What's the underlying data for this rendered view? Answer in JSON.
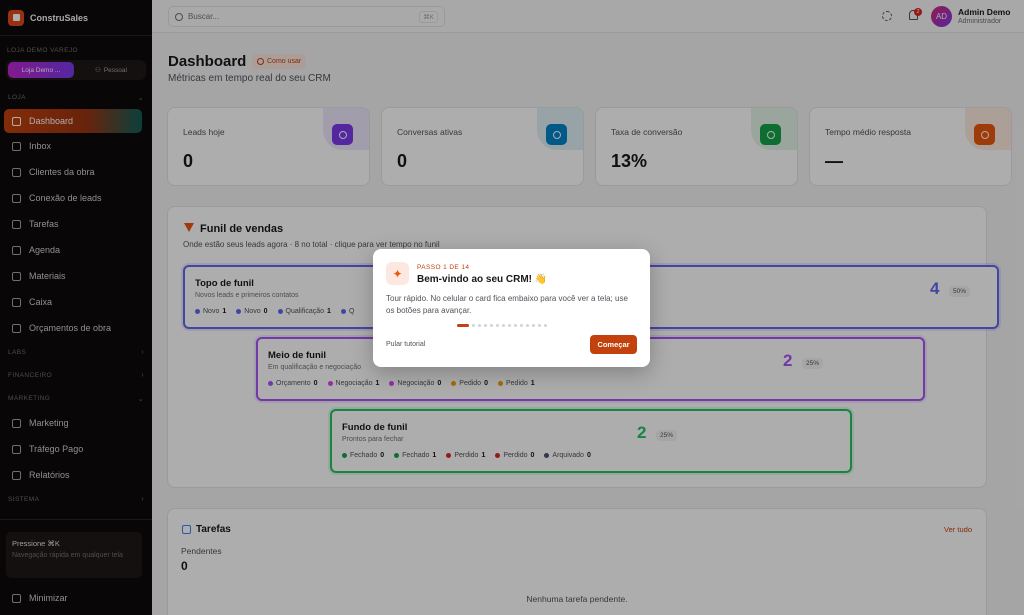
{
  "app": {
    "name": "ConstruSales"
  },
  "store": {
    "section_label": "LOJA DEMO VAREJO",
    "active": "Loja Demo ...",
    "personal": "Pessoal"
  },
  "sidebar": {
    "loja_label": "LOJA",
    "items": [
      {
        "label": "Dashboard",
        "icon": "dashboard-icon"
      },
      {
        "label": "Inbox",
        "icon": "inbox-icon"
      },
      {
        "label": "Clientes da obra",
        "icon": "users-icon"
      },
      {
        "label": "Conexão de leads",
        "icon": "document-icon"
      },
      {
        "label": "Tarefas",
        "icon": "tasks-icon"
      },
      {
        "label": "Agenda",
        "icon": "calendar-icon"
      },
      {
        "label": "Materiais",
        "icon": "box-icon"
      },
      {
        "label": "Caixa",
        "icon": "cart-icon"
      },
      {
        "label": "Orçamentos de obra",
        "icon": "file-icon"
      }
    ],
    "labs_label": "LABS",
    "financeiro_label": "FINANCEIRO",
    "marketing_label": "MARKETING",
    "marketing_items": [
      {
        "label": "Marketing",
        "icon": "mail-icon"
      },
      {
        "label": "Tráfego Pago",
        "icon": "trend-icon"
      },
      {
        "label": "Relatórios",
        "icon": "chart-icon"
      }
    ],
    "sistema_label": "SISTEMA",
    "shortcut_title": "Pressione ⌘K",
    "shortcut_desc": "Navegação rápida em qualquer tela",
    "minimize": "Minimizar"
  },
  "topbar": {
    "search_placeholder": "Buscar...",
    "search_kbd": "⌘K",
    "notif_count": "2",
    "avatar_initials": "AD",
    "user_name": "Admin Demo",
    "user_role": "Administrador"
  },
  "header": {
    "title": "Dashboard",
    "howto": "Como usar",
    "subtitle": "Métricas em tempo real do seu CRM"
  },
  "stats": [
    {
      "label": "Leads hoje",
      "value": "0",
      "color": "#7c3aed"
    },
    {
      "label": "Conversas ativas",
      "value": "0",
      "color": "#0284c7"
    },
    {
      "label": "Taxa de conversão",
      "value": "13%",
      "color": "#16a34a"
    },
    {
      "label": "Tempo médio resposta",
      "value": "—",
      "color": "#ea580c"
    }
  ],
  "funnel": {
    "title": "Funil de vendas",
    "subtitle": "Onde estão seus leads agora · 8 no total · clique para ver tempo no funil",
    "stages": [
      {
        "name": "Topo de funil",
        "desc": "Novos leads e primeiros contatos",
        "count": "4",
        "pct": "50%",
        "color": "#6366f1",
        "tags": [
          {
            "label": "Novo",
            "n": "1",
            "color": "#6366f1"
          },
          {
            "label": "Novo",
            "n": "0",
            "color": "#6366f1"
          },
          {
            "label": "Qualificação",
            "n": "1",
            "color": "#6366f1"
          },
          {
            "label": "Q",
            "n": "",
            "color": "#6366f1"
          }
        ]
      },
      {
        "name": "Meio de funil",
        "desc": "Em qualificação e negociação",
        "count": "2",
        "pct": "25%",
        "color": "#a855f7",
        "tags": [
          {
            "label": "Orçamento",
            "n": "0",
            "color": "#a855f7"
          },
          {
            "label": "Negociação",
            "n": "1",
            "color": "#d946ef"
          },
          {
            "label": "Negociação",
            "n": "0",
            "color": "#d946ef"
          },
          {
            "label": "Pedido",
            "n": "0",
            "color": "#f59e0b"
          },
          {
            "label": "Pedido",
            "n": "1",
            "color": "#f59e0b"
          }
        ]
      },
      {
        "name": "Fundo de funil",
        "desc": "Prontos para fechar",
        "count": "2",
        "pct": "25%",
        "color": "#22c55e",
        "tags": [
          {
            "label": "Fechado",
            "n": "0",
            "color": "#16a34a"
          },
          {
            "label": "Fechado",
            "n": "1",
            "color": "#16a34a"
          },
          {
            "label": "Perdido",
            "n": "1",
            "color": "#dc2626"
          },
          {
            "label": "Perdido",
            "n": "0",
            "color": "#dc2626"
          },
          {
            "label": "Arquivado",
            "n": "0",
            "color": "#475569"
          }
        ]
      }
    ]
  },
  "tasks": {
    "title": "Tarefas",
    "link": "Ver tudo",
    "pending_label": "Pendentes",
    "pending_count": "0",
    "empty": "Nenhuma tarefa pendente."
  },
  "tour": {
    "step": "PASSO 1 DE 14",
    "title": "Bem-vindo ao seu CRM! 👋",
    "body": "Tour rápido. No celular o card fica embaixo para você ver a tela; use os botões para avançar.",
    "skip": "Pular tutorial",
    "start": "Começar",
    "total_steps": 14,
    "current_step": 1
  }
}
